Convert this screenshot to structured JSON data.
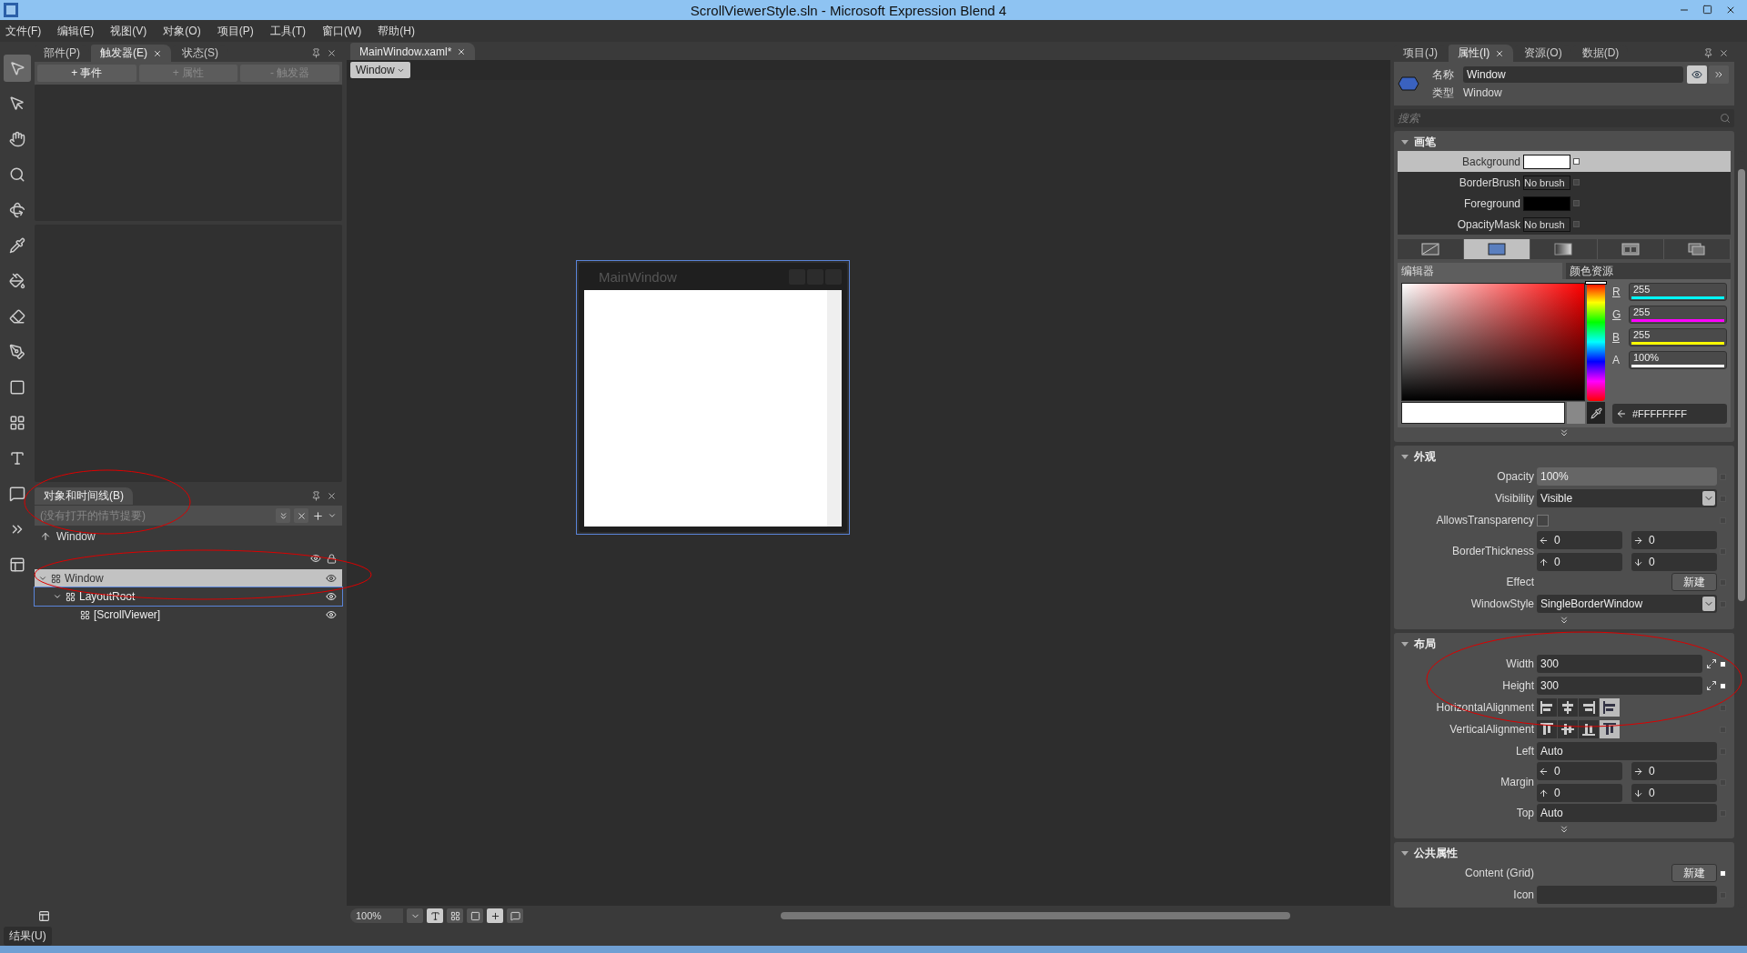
{
  "window": {
    "title": "ScrollViewerStyle.sln - Microsoft Expression Blend 4"
  },
  "menu": [
    "文件(F)",
    "编辑(E)",
    "视图(V)",
    "对象(O)",
    "项目(P)",
    "工具(T)",
    "窗口(W)",
    "帮助(H)"
  ],
  "left_panel": {
    "tabs": [
      {
        "label": "部件(P)",
        "selected": false
      },
      {
        "label": "触发器(E)",
        "selected": true
      },
      {
        "label": "状态(S)",
        "selected": false
      }
    ],
    "buttons": [
      {
        "label": "+ 事件",
        "disabled": false
      },
      {
        "label": "+ 属性",
        "disabled": true
      },
      {
        "label": "- 触发器",
        "disabled": true
      }
    ]
  },
  "objects_panel": {
    "title": "对象和时间线(B)",
    "storyboard": "(没有打开的情节提要)",
    "scope": "Window",
    "tree": [
      {
        "label": "Window",
        "selected": true,
        "hovered": false,
        "expanded": true,
        "children": [
          {
            "label": "LayoutRoot",
            "selected": false,
            "hovered": true,
            "expanded": true,
            "children": [
              {
                "label": "[ScrollViewer]",
                "selected": false,
                "hovered": false
              }
            ]
          }
        ]
      }
    ]
  },
  "document": {
    "tabs": [
      {
        "label": "MainWindow.xaml*",
        "selected": true
      }
    ],
    "breadcrumb": "Window",
    "artboard": {
      "title": "MainWindow"
    },
    "zoom": "100%"
  },
  "properties_panel": {
    "tabs": [
      {
        "label": "项目(J)",
        "selected": false
      },
      {
        "label": "属性(I)",
        "selected": true
      },
      {
        "label": "资源(O)",
        "selected": false
      },
      {
        "label": "数据(D)",
        "selected": false
      }
    ],
    "name_label": "名称",
    "name": "Window",
    "type_label": "类型",
    "type": "Window",
    "search_placeholder": "搜索",
    "brush": {
      "title": "画笔",
      "rows": [
        {
          "label": "Background",
          "color": "#ffffff",
          "selected": true
        },
        {
          "label": "BorderBrush",
          "value": "No brush",
          "selected": false
        },
        {
          "label": "Foreground",
          "color": "#000000",
          "selected": false
        },
        {
          "label": "OpacityMask",
          "value": "No brush",
          "selected": false
        }
      ],
      "types": [
        {
          "kind": "none",
          "selected": false
        },
        {
          "kind": "solid",
          "selected": true
        },
        {
          "kind": "gradient",
          "selected": false
        },
        {
          "kind": "tile",
          "selected": false
        },
        {
          "kind": "resource",
          "selected": false
        }
      ],
      "editor_tabs": [
        {
          "label": "编辑器",
          "selected": true
        },
        {
          "label": "颜色资源",
          "selected": false
        }
      ],
      "channels": [
        {
          "label": "R",
          "value": "255",
          "color": "#00ffff"
        },
        {
          "label": "G",
          "value": "255",
          "color": "#ff00ff"
        },
        {
          "label": "B",
          "value": "255",
          "color": "#ffff00"
        },
        {
          "label": "A",
          "value": "100%",
          "color": "#ffffff"
        }
      ],
      "hue": {
        "level": 0
      },
      "hex": "#FFFFFFFF"
    },
    "sections": [
      {
        "title": "外观",
        "rows": [
          {
            "kind": "text",
            "label": "Opacity",
            "value": "100%",
            "set": false
          },
          {
            "kind": "dropdown",
            "label": "Visibility",
            "value": "Visible",
            "set": false
          },
          {
            "kind": "checkbox",
            "label": "AllowsTransparency",
            "checked": false,
            "set": false
          },
          {
            "kind": "quad",
            "label": "BorderThickness",
            "values": [
              "0",
              "0",
              "0",
              "0"
            ],
            "set": false
          },
          {
            "kind": "button",
            "label": "Effect",
            "value": "新建",
            "set": false
          },
          {
            "kind": "dropdown",
            "label": "WindowStyle",
            "value": "SingleBorderWindow",
            "set": false
          }
        ]
      },
      {
        "title": "布局",
        "rows": [
          {
            "kind": "size",
            "label": "Width",
            "value": "300",
            "set": true
          },
          {
            "kind": "size",
            "label": "Height",
            "value": "300",
            "set": true
          },
          {
            "kind": "halign",
            "label": "HorizontalAlignment",
            "options": [
              {
                "selected": false
              },
              {
                "selected": false
              },
              {
                "selected": false
              },
              {
                "selected": true
              }
            ],
            "set": false
          },
          {
            "kind": "valign",
            "label": "VerticalAlignment",
            "options": [
              {
                "selected": false
              },
              {
                "selected": false
              },
              {
                "selected": false
              },
              {
                "selected": true
              }
            ],
            "set": false
          },
          {
            "kind": "text",
            "label": "Left",
            "value": "Auto",
            "set": false
          },
          {
            "kind": "quad",
            "label": "Margin",
            "values": [
              "0",
              "0",
              "0",
              "0"
            ],
            "set": false
          },
          {
            "kind": "text",
            "label": "Top",
            "value": "Auto",
            "set": false
          }
        ]
      },
      {
        "title": "公共属性",
        "rows": [
          {
            "kind": "button",
            "label": "Content (Grid)",
            "value": "新建",
            "set": true
          },
          {
            "kind": "text",
            "label": "Icon",
            "set": false
          }
        ]
      }
    ]
  },
  "status_bar": {
    "label": "结果(U)"
  }
}
